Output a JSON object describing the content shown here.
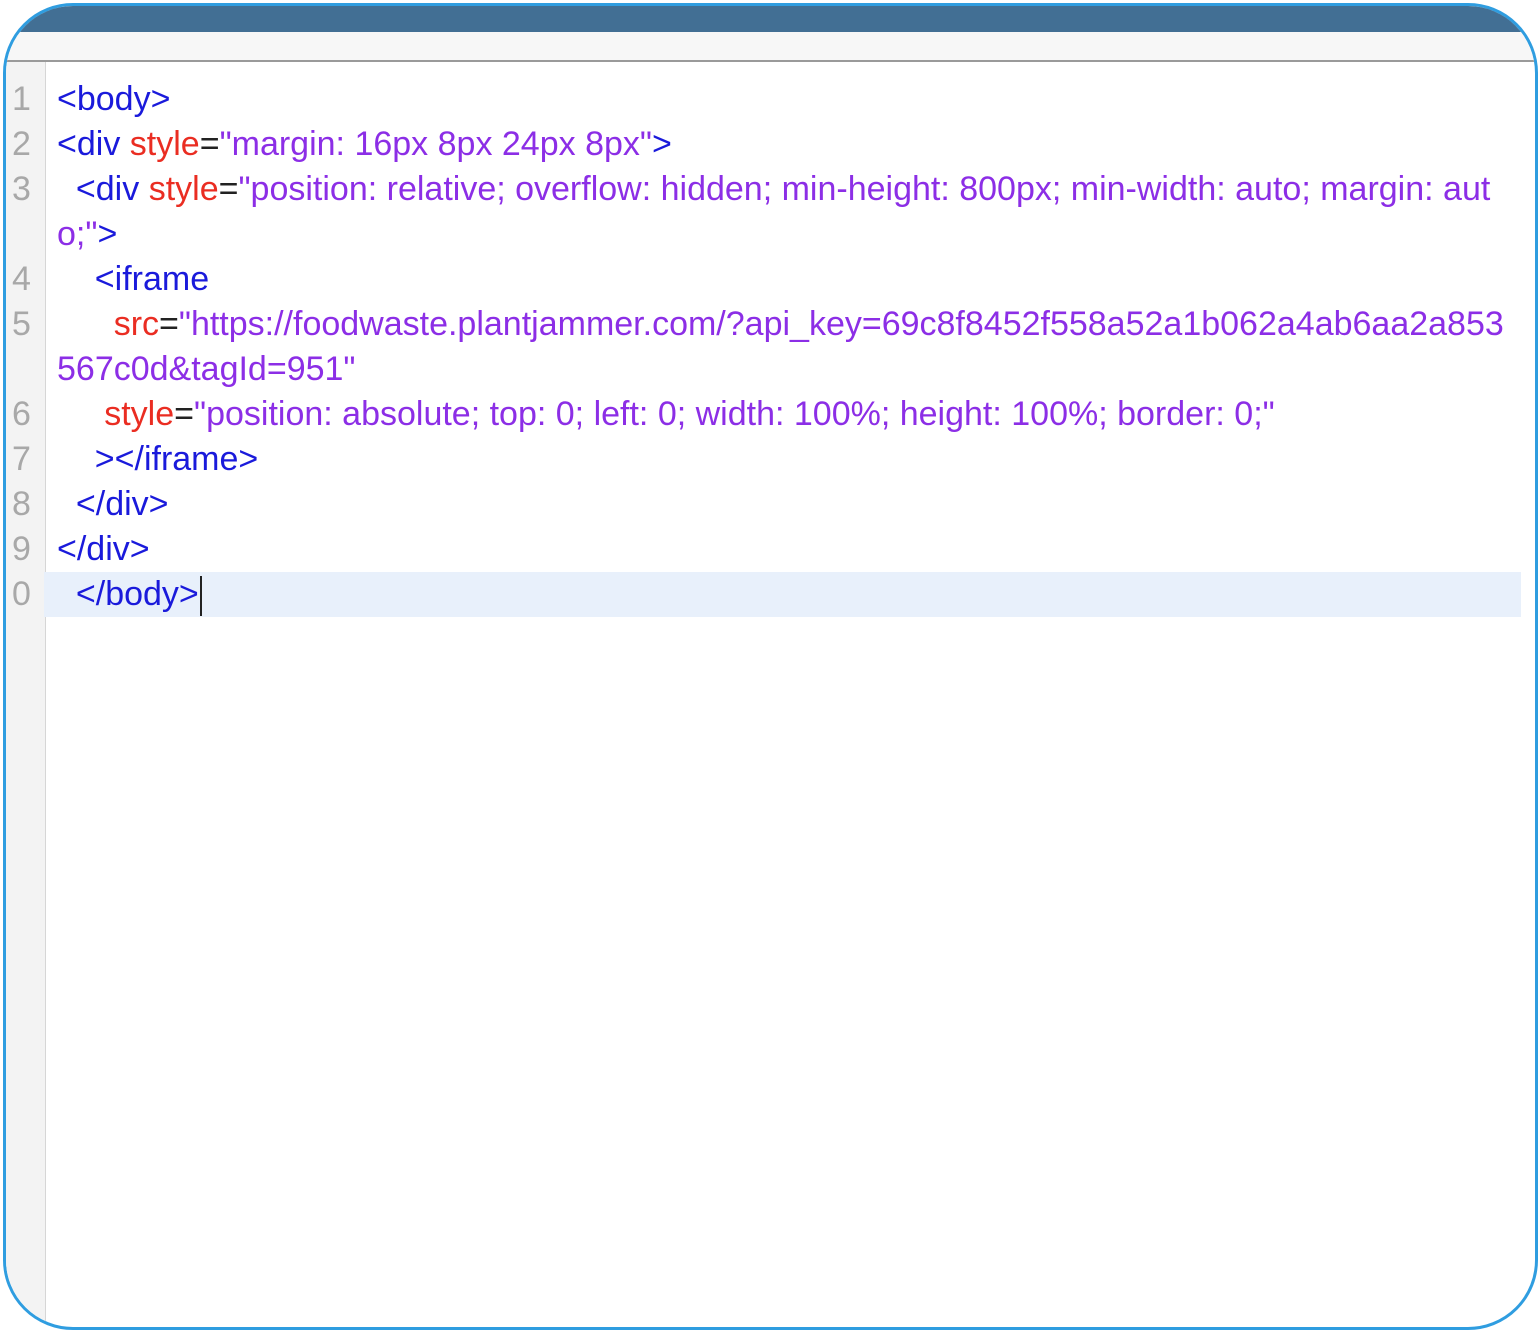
{
  "editor": {
    "lines": [
      {
        "num": "1",
        "tag_open": "<body>"
      },
      {
        "num": "2",
        "indent": "",
        "tag": "<div",
        "attr": "style",
        "eq": "=",
        "val": "\"margin: 16px 8px 24px 8px\"",
        "tag_close": ">"
      },
      {
        "num": "3",
        "indent": "  ",
        "tag": "<div",
        "attr": "style",
        "eq": "=",
        "val": "\"position: relative; overflow: hidden; min-height: 800px; min-width: auto; margin: auto;\"",
        "tag_close": ">"
      },
      {
        "num": "4",
        "indent": "    ",
        "tag": "<iframe"
      },
      {
        "num": "5",
        "indent": "      ",
        "attr": "src",
        "eq": "=",
        "val": "\"https://foodwaste.plantjammer.com/?api_key=69c8f8452f558a52a1b062a4ab6aa2a853567c0d&tagId=951\""
      },
      {
        "num": "6",
        "indent": "     ",
        "attr": "style",
        "eq": "=",
        "val": "\"position: absolute; top: 0; left: 0; width: 100%; height: 100%; border: 0;\""
      },
      {
        "num": "7",
        "indent": "    ",
        "tag": "></iframe>"
      },
      {
        "num": "8",
        "indent": "  ",
        "tag": "</div>"
      },
      {
        "num": "9",
        "indent": "",
        "tag": "</div>"
      },
      {
        "num": "0",
        "indent": "  ",
        "tag": "</body>"
      }
    ]
  }
}
